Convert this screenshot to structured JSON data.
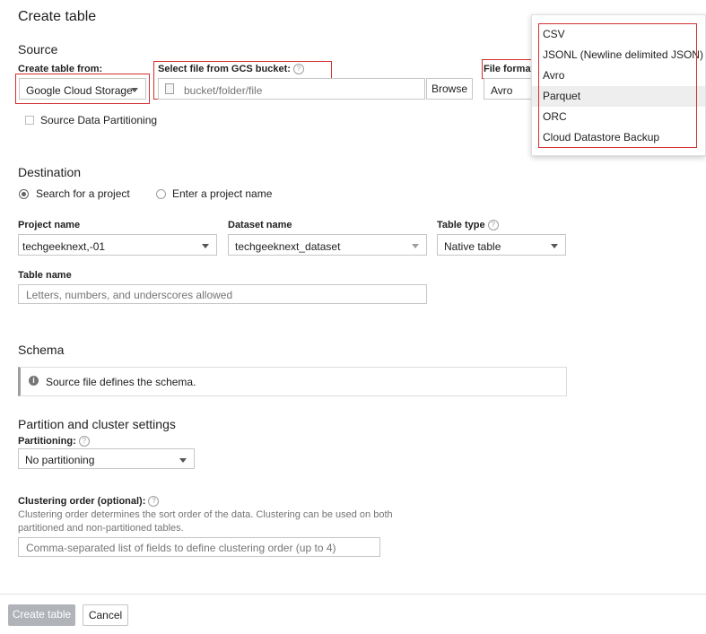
{
  "page": {
    "title": "Create table"
  },
  "source": {
    "heading": "Source",
    "create_from_label": "Create table from:",
    "create_from_value": "Google Cloud Storage",
    "gcs_label": "Select file from GCS bucket:",
    "gcs_placeholder": "bucket/folder/file",
    "browse_label": "Browse",
    "file_format_label": "File format:",
    "file_format_value": "Avro",
    "partitioning_checkbox_label": "Source Data Partitioning",
    "format_options": [
      "CSV",
      "JSONL (Newline delimited JSON)",
      "Avro",
      "Parquet",
      "ORC",
      "Cloud Datastore Backup"
    ],
    "highlighted_option": "Parquet"
  },
  "destination": {
    "heading": "Destination",
    "radio_search": "Search for a project",
    "radio_enter": "Enter a project name",
    "project_label": "Project name",
    "project_value": "techgeeknext,-01",
    "dataset_label": "Dataset name",
    "dataset_value": "techgeeknext_dataset",
    "table_type_label": "Table type",
    "table_type_value": "Native table",
    "table_name_label": "Table name",
    "table_name_placeholder": "Letters, numbers, and underscores allowed"
  },
  "schema": {
    "heading": "Schema",
    "info_text": "Source file defines the schema."
  },
  "partition": {
    "heading": "Partition and cluster settings",
    "partitioning_label": "Partitioning:",
    "partitioning_value": "No partitioning",
    "clustering_label": "Clustering order (optional):",
    "clustering_desc_1": "Clustering order determines the sort order of the data. Clustering can be used on both",
    "clustering_desc_2": "partitioned and non-partitioned tables.",
    "clustering_placeholder": "Comma-separated list of fields to define clustering order (up to 4)"
  },
  "footer": {
    "create_label": "Create table",
    "cancel_label": "Cancel"
  },
  "colors": {
    "highlight": "#d32f2f",
    "disabled_button": "#b0b3b8"
  }
}
